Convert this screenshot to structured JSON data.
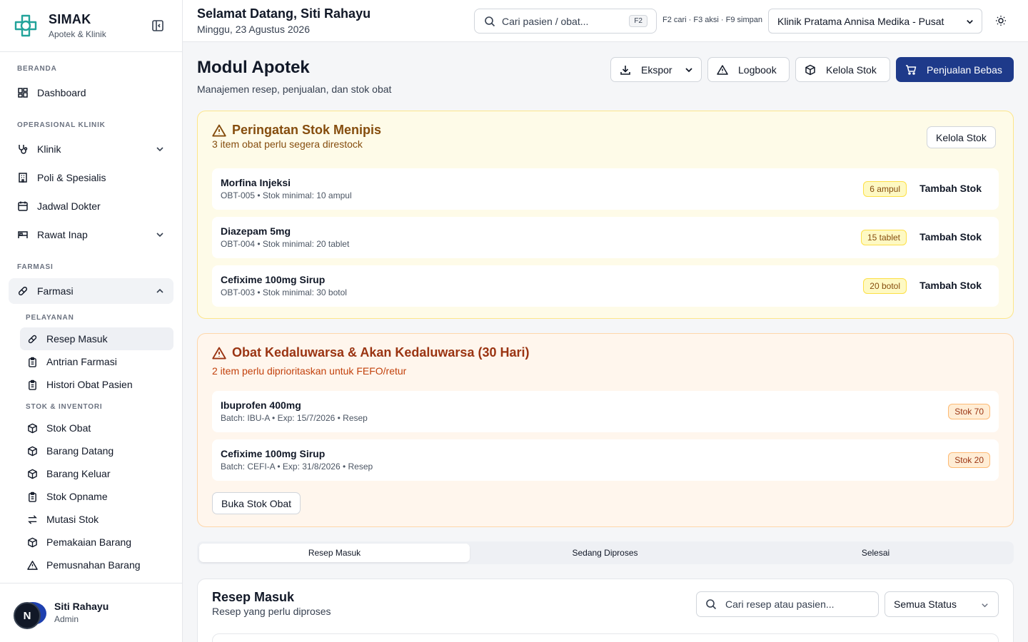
{
  "brand": {
    "name": "SIMAK",
    "subtitle": "Apotek & Klinik"
  },
  "sidebar": {
    "sections": [
      "BERANDA",
      "OPERASIONAL KLINIK",
      "FARMASI"
    ],
    "items": {
      "dashboard": "Dashboard",
      "klinik": "Klinik",
      "poli": "Poli & Spesialis",
      "jadwal": "Jadwal Dokter",
      "rawat_inap": "Rawat Inap",
      "farmasi": "Farmasi"
    },
    "sub_labels": [
      "PELAYANAN",
      "STOK & INVENTORI"
    ],
    "pelayanan": [
      "Resep Masuk",
      "Antrian Farmasi",
      "Histori Obat Pasien"
    ],
    "stok": [
      "Stok Obat",
      "Barang Datang",
      "Barang Keluar",
      "Stok Opname",
      "Mutasi Stok",
      "Pemakaian Barang",
      "Pemusnahan Barang"
    ]
  },
  "user": {
    "initial": "N",
    "name": "Siti Rahayu",
    "role": "Admin"
  },
  "header": {
    "greeting": "Selamat Datang, Siti Rahayu",
    "date": "Minggu, 23 Agustus 2026",
    "search_placeholder": "Cari pasien / obat...",
    "search_kbd": "F2",
    "hints": "F2 cari · F3 aksi · F9 simpan",
    "clinic": "Klinik Pratama Annisa Medika - Pusat"
  },
  "page": {
    "title": "Modul Apotek",
    "subtitle": "Manajemen resep, penjualan, dan stok obat",
    "actions": {
      "export": "Ekspor",
      "logbook": "Logbook",
      "manage_stock": "Kelola Stok",
      "sale": "Penjualan Bebas"
    }
  },
  "low_stock": {
    "title": "Peringatan Stok Menipis",
    "desc": "3 item obat perlu segera direstock",
    "button": "Kelola Stok",
    "add_label": "Tambah Stok",
    "items": [
      {
        "name": "Morfina Injeksi",
        "meta": "OBT-005 • Stok minimal: 10 ampul",
        "badge": "6 ampul"
      },
      {
        "name": "Diazepam 5mg",
        "meta": "OBT-004 • Stok minimal: 20 tablet",
        "badge": "15 tablet"
      },
      {
        "name": "Cefixime 100mg Sirup",
        "meta": "OBT-003 • Stok minimal: 30 botol",
        "badge": "20 botol"
      }
    ]
  },
  "expiry": {
    "title": "Obat Kedaluwarsa & Akan Kedaluwarsa (30 Hari)",
    "desc": "2 item perlu diprioritaskan untuk FEFO/retur",
    "button": "Buka Stok Obat",
    "items": [
      {
        "name": "Ibuprofen 400mg",
        "meta": "Batch: IBU-A • Exp: 15/7/2026 • Resep",
        "badge": "Stok 70"
      },
      {
        "name": "Cefixime 100mg Sirup",
        "meta": "Batch: CEFI-A • Exp: 31/8/2026 • Resep",
        "badge": "Stok 20"
      }
    ]
  },
  "tabs": [
    "Resep Masuk",
    "Sedang Diproses",
    "Selesai"
  ],
  "resep": {
    "title": "Resep Masuk",
    "subtitle": "Resep yang perlu diproses",
    "search_placeholder": "Cari resep atau pasien...",
    "status": "Semua Status"
  }
}
